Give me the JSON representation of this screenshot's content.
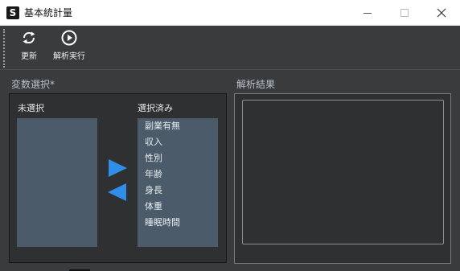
{
  "window": {
    "app_icon_letter": "S",
    "title": "基本統計量",
    "controls": [
      "minimize-icon",
      "maximize-icon",
      "close-icon"
    ]
  },
  "toolbar": {
    "refresh_label": "更新",
    "refresh_icon": "refresh-icon",
    "run_label": "解析実行",
    "run_icon": "play-circle-icon"
  },
  "variables": {
    "section_title": "変数選択*",
    "unselected_label": "未選択",
    "selected_label": "選択済み",
    "unselected_items": [],
    "selected_items": [
      "副業有無",
      "収入",
      "性別",
      "年齢",
      "身長",
      "体重",
      "睡眠時間"
    ],
    "move_right_icon": "triangle-right-icon",
    "move_left_icon": "triangle-left-icon"
  },
  "results": {
    "section_title": "解析結果",
    "content": ""
  },
  "colors": {
    "background": "#3a3b3d",
    "panel": "#2f3031",
    "list_bg": "#4b5b6a",
    "arrow_accent": "#2f8fe8",
    "section_title": "#b9c0c6"
  }
}
